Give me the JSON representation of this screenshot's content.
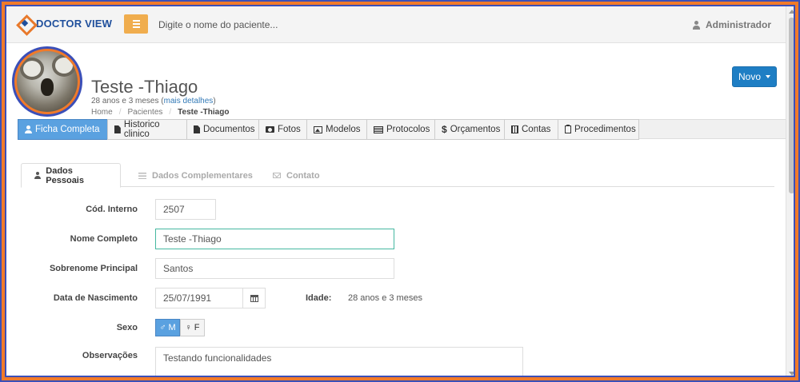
{
  "brand": {
    "name": "DOCTOR VIEW"
  },
  "navbar": {
    "search_placeholder": "Digite o nome do paciente...",
    "user": "Administrador"
  },
  "patient": {
    "name": "Teste -Thiago",
    "age_prefix": "28 anos e 3 meses (",
    "details_link": "mais detalhes",
    "age_suffix": ")"
  },
  "breadcrumb": {
    "home": "Home",
    "patients": "Pacientes",
    "current": "Teste -Thiago"
  },
  "actions": {
    "novo_label": "Novo"
  },
  "tabs": [
    {
      "label": "Ficha Completa",
      "icon": "user-icon",
      "active": true
    },
    {
      "label": "Historico clinico",
      "icon": "file-icon"
    },
    {
      "label": "Documentos",
      "icon": "file-icon"
    },
    {
      "label": "Fotos",
      "icon": "camera-icon"
    },
    {
      "label": "Modelos",
      "icon": "picture-icon"
    },
    {
      "label": "Protocolos",
      "icon": "list-alt-icon"
    },
    {
      "label": "Orçamentos",
      "icon": "dollar-icon"
    },
    {
      "label": "Contas",
      "icon": "calculator-icon"
    },
    {
      "label": "Procedimentos",
      "icon": "clipboard-icon"
    }
  ],
  "subtabs": [
    {
      "label": "Dados Pessoais",
      "icon": "user-icon",
      "active": true
    },
    {
      "label": "Dados Complementares",
      "icon": "list-icon"
    },
    {
      "label": "Contato",
      "icon": "envelope-icon"
    }
  ],
  "form": {
    "cod_interno": {
      "label": "Cód. Interno",
      "value": "2507"
    },
    "nome_completo": {
      "label": "Nome Completo",
      "value": "Teste -Thiago"
    },
    "sobrenome": {
      "label": "Sobrenome Principal",
      "value": "Santos"
    },
    "nascimento": {
      "label": "Data de Nascimento",
      "value": "25/07/1991"
    },
    "idade": {
      "label": "Idade:",
      "value": "28 anos e 3 meses"
    },
    "sexo": {
      "label": "Sexo",
      "male": "♂ M",
      "female": "♀ F",
      "selected": "M"
    },
    "observacoes": {
      "label": "Observações",
      "value": "Testando funcionalidades"
    }
  },
  "colors": {
    "primary": "#1e7ec4",
    "active_tab": "#5aa1e0",
    "menu_button": "#f0ad4e",
    "brand_blue": "#1f4f9c",
    "brand_orange": "#e8792b"
  }
}
